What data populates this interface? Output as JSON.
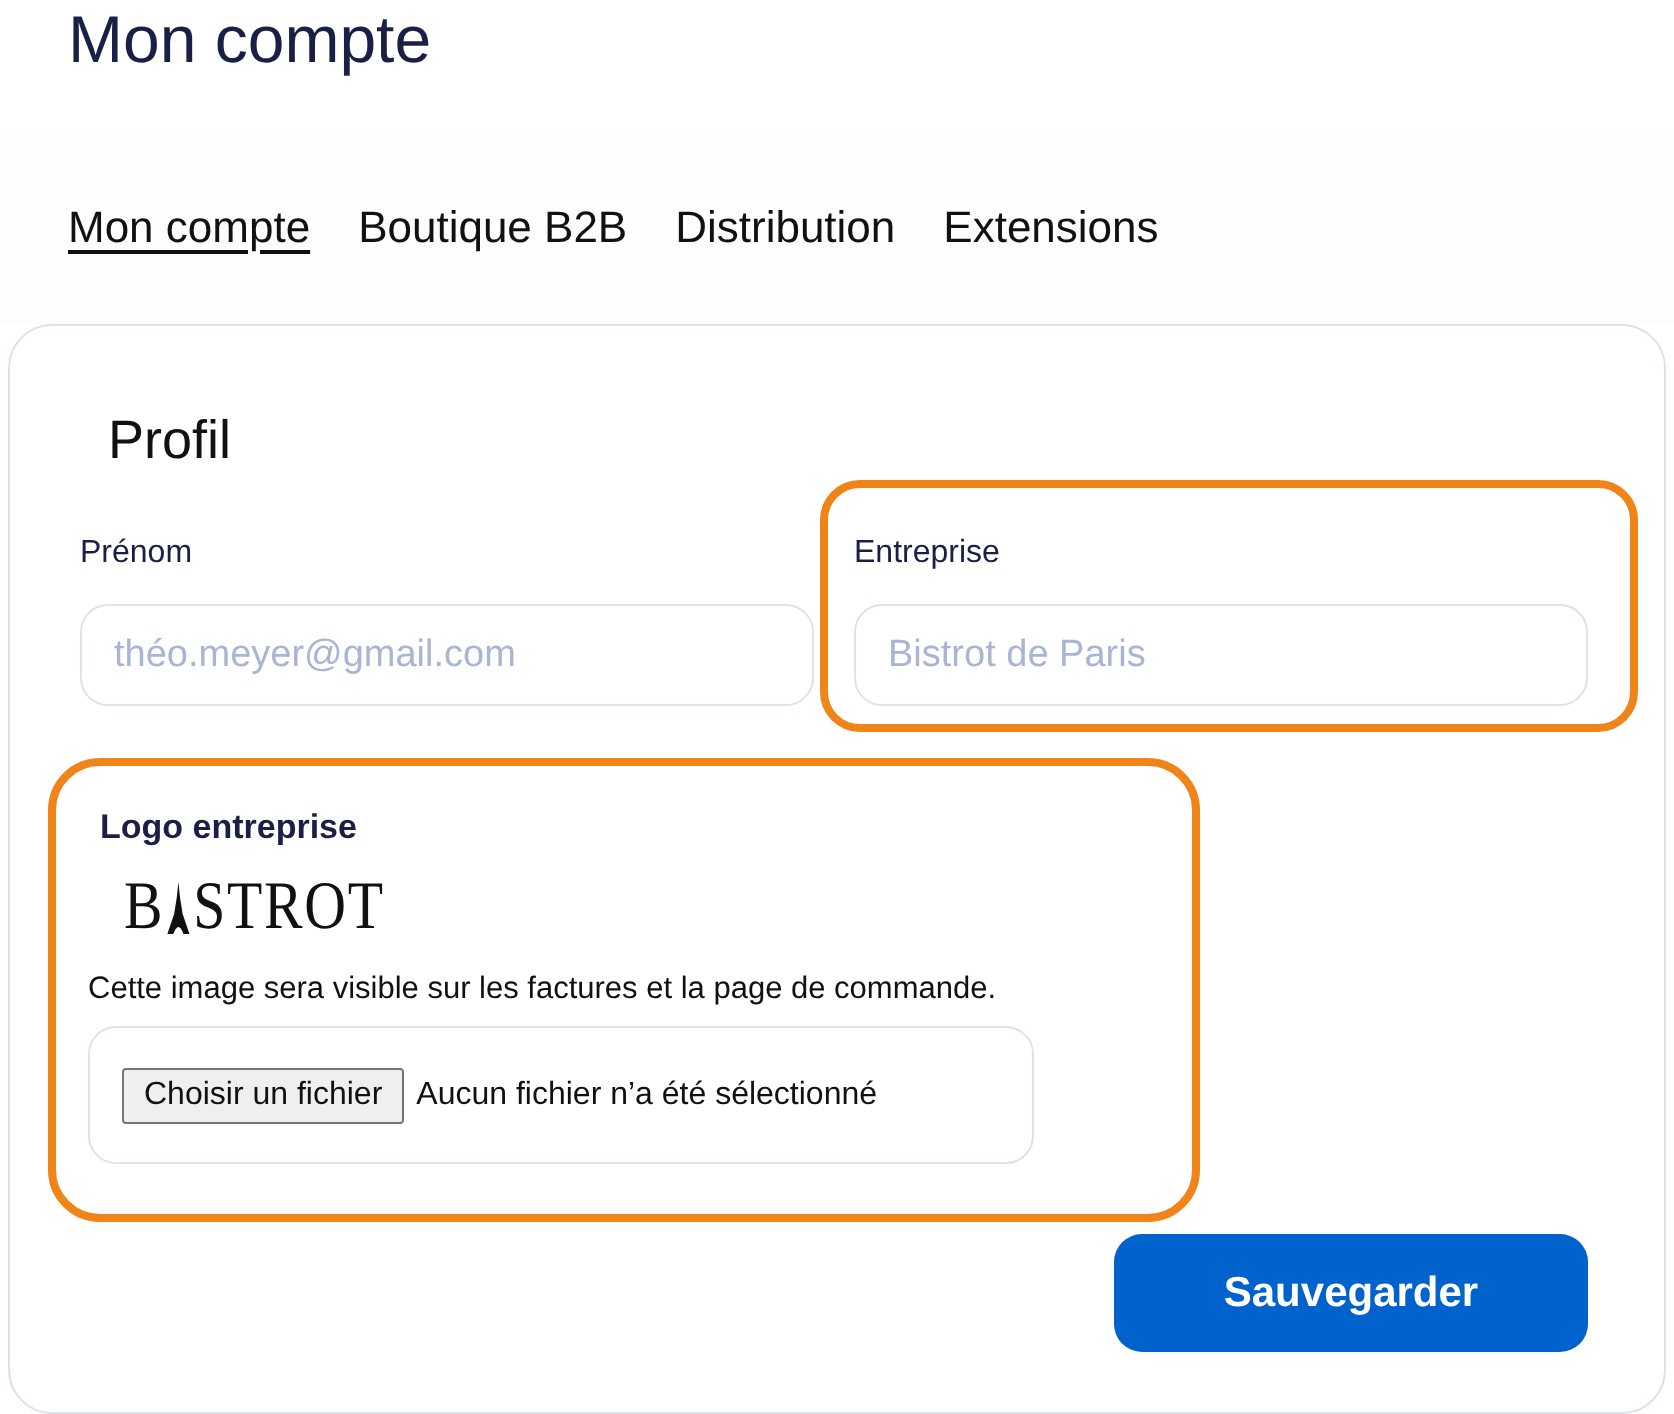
{
  "page_title": "Mon compte",
  "tabs": [
    {
      "label": "Mon compte",
      "selected": true
    },
    {
      "label": "Boutique B2B",
      "selected": false
    },
    {
      "label": "Distribution",
      "selected": false
    },
    {
      "label": "Extensions",
      "selected": false
    }
  ],
  "profile": {
    "title": "Profil",
    "fields": [
      {
        "label": "Prénom",
        "placeholder": "théo.meyer@gmail.com",
        "highlighted": false
      },
      {
        "label": "Entreprise",
        "placeholder": "Bistrot de Paris",
        "highlighted": true
      }
    ],
    "logo_section": {
      "title": "Logo entreprise",
      "highlighted": true,
      "logo": {
        "text_start": "B",
        "text_end": "STROT"
      },
      "description": "Cette image sera visible sur les factures et la page de commande.",
      "file_button": "Choisir un fichier",
      "file_status": "Aucun fichier n’a été sélectionné"
    },
    "save_button": "Sauvegarder"
  }
}
